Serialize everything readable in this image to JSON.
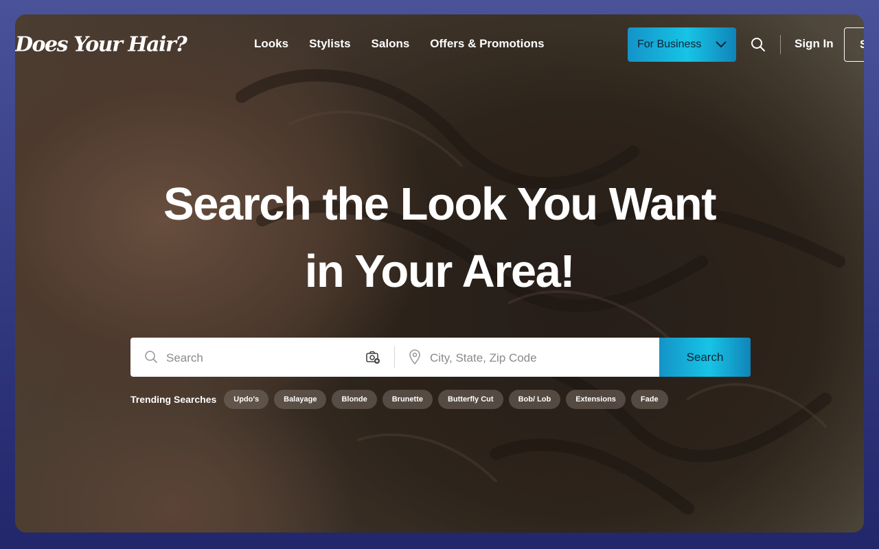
{
  "brand": {
    "logo_text": "Does Your Hair?"
  },
  "nav": {
    "links": [
      "Looks",
      "Stylists",
      "Salons",
      "Offers & Promotions"
    ],
    "for_business": "For Business",
    "sign_in": "Sign In",
    "sign_up_partial": "S"
  },
  "hero": {
    "line1": "Search the Look You Want",
    "line2": "in Your Area!"
  },
  "search": {
    "query_placeholder": "Search",
    "location_placeholder": "City, State, Zip Code",
    "button": "Search"
  },
  "trending": {
    "label": "Trending Searches",
    "chips": [
      "Updo's",
      "Balayage",
      "Blonde",
      "Brunette",
      "Butterfly Cut",
      "Bob/ Lob",
      "Extensions",
      "Fade"
    ]
  },
  "colors": {
    "accent": "#17c4e6",
    "page_background": "#33397f"
  },
  "icons": [
    "search-icon",
    "chevron-down-icon",
    "camera-icon",
    "map-pin-icon"
  ]
}
